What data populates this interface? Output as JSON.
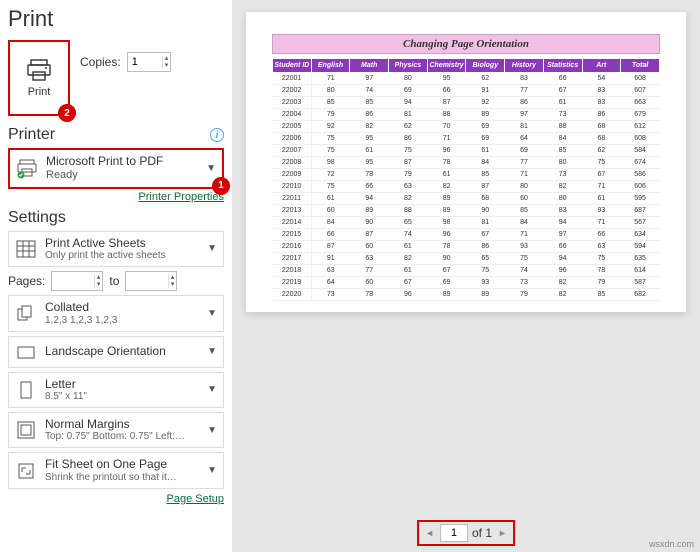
{
  "title": "Print",
  "copies": {
    "label": "Copies:",
    "value": "1"
  },
  "print_button": {
    "label": "Print",
    "badge": "2"
  },
  "printer_section": {
    "heading": "Printer",
    "name": "Microsoft Print to PDF",
    "status": "Ready",
    "properties_link": "Printer Properties",
    "badge": "1"
  },
  "settings": {
    "heading": "Settings",
    "print_what": {
      "line1": "Print Active Sheets",
      "line2": "Only print the active sheets"
    },
    "pages": {
      "label": "Pages:",
      "to": "to"
    },
    "collate": {
      "line1": "Collated",
      "line2": "1,2,3   1,2,3   1,2,3"
    },
    "orientation": {
      "line1": "Landscape Orientation"
    },
    "paper": {
      "line1": "Letter",
      "line2": "8.5\" x 11\""
    },
    "margins": {
      "line1": "Normal Margins",
      "line2": "Top: 0.75\" Bottom: 0.75\" Left:…"
    },
    "scaling": {
      "line1": "Fit Sheet on One Page",
      "line2": "Shrink the printout so that it…"
    },
    "page_setup_link": "Page Setup"
  },
  "preview": {
    "title": "Changing Page Orientation",
    "headers": [
      "Student ID",
      "English",
      "Math",
      "Physics",
      "Chemistry",
      "Biology",
      "History",
      "Statistics",
      "Art",
      "Total"
    ],
    "rows": [
      [
        "22001",
        "71",
        "97",
        "80",
        "95",
        "62",
        "83",
        "66",
        "54",
        "608"
      ],
      [
        "22002",
        "80",
        "74",
        "69",
        "66",
        "91",
        "77",
        "67",
        "83",
        "607"
      ],
      [
        "22003",
        "85",
        "85",
        "94",
        "87",
        "92",
        "86",
        "61",
        "83",
        "663"
      ],
      [
        "22004",
        "79",
        "86",
        "81",
        "88",
        "89",
        "97",
        "73",
        "86",
        "679"
      ],
      [
        "22005",
        "92",
        "82",
        "62",
        "70",
        "69",
        "81",
        "88",
        "68",
        "612"
      ],
      [
        "22006",
        "75",
        "95",
        "86",
        "71",
        "69",
        "64",
        "84",
        "68",
        "608"
      ],
      [
        "22007",
        "75",
        "61",
        "75",
        "96",
        "61",
        "69",
        "85",
        "62",
        "584"
      ],
      [
        "22008",
        "98",
        "95",
        "87",
        "78",
        "84",
        "77",
        "80",
        "75",
        "674"
      ],
      [
        "22009",
        "72",
        "78",
        "79",
        "61",
        "85",
        "71",
        "73",
        "67",
        "586"
      ],
      [
        "22010",
        "75",
        "66",
        "63",
        "82",
        "87",
        "80",
        "82",
        "71",
        "606"
      ],
      [
        "22011",
        "61",
        "94",
        "82",
        "89",
        "68",
        "60",
        "80",
        "61",
        "595"
      ],
      [
        "22013",
        "60",
        "89",
        "88",
        "89",
        "90",
        "85",
        "83",
        "93",
        "687"
      ],
      [
        "22014",
        "84",
        "90",
        "65",
        "98",
        "81",
        "84",
        "94",
        "71",
        "567"
      ],
      [
        "22015",
        "66",
        "87",
        "74",
        "96",
        "67",
        "71",
        "97",
        "66",
        "634"
      ],
      [
        "22016",
        "87",
        "60",
        "61",
        "78",
        "86",
        "93",
        "66",
        "63",
        "594"
      ],
      [
        "22017",
        "91",
        "63",
        "82",
        "90",
        "65",
        "75",
        "94",
        "75",
        "635"
      ],
      [
        "22018",
        "63",
        "77",
        "61",
        "67",
        "75",
        "74",
        "96",
        "78",
        "614"
      ],
      [
        "22019",
        "64",
        "60",
        "67",
        "69",
        "93",
        "73",
        "82",
        "79",
        "587"
      ],
      [
        "22020",
        "73",
        "78",
        "96",
        "89",
        "89",
        "79",
        "82",
        "85",
        "682"
      ]
    ]
  },
  "pager": {
    "current": "1",
    "of": "of 1"
  },
  "watermark": "wsxdn.com"
}
